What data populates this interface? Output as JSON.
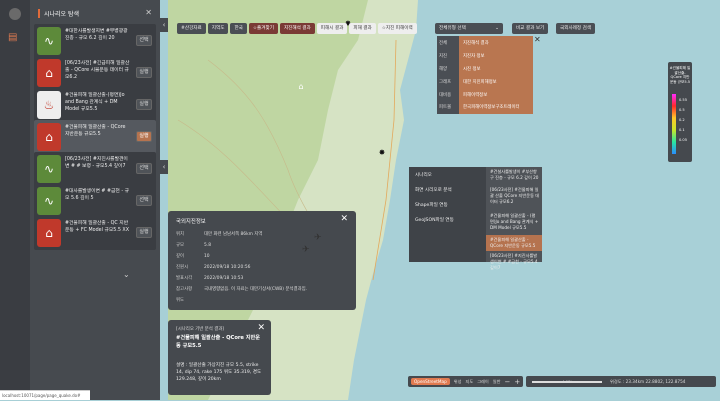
{
  "sidebar": {
    "panel_title": "시나리오 탐색",
    "items": [
      {
        "text": "#대한사를발생지변 #부병광광진층 - 규모 6.2 깊이 20",
        "button": "선택",
        "icon": "seismic",
        "color": "green"
      },
      {
        "text": "[06/23사전] #긴급피해 일괄산출 - QCore 시뮬운동 데이터 규모6.2",
        "button": "실행",
        "icon": "house",
        "color": "red"
      },
      {
        "text": "#건물피해 일괄산출-(평면)Jo and Bang 관계식 + DM Model 규모5.5",
        "button": "실행",
        "icon": "collapse",
        "color": "white"
      },
      {
        "text": "#건물피해 일괄산출 - QCore 지반운동 규모5.5",
        "button": "실행",
        "icon": "house",
        "color": "red",
        "active": true
      },
      {
        "text": "[06/23사전] #지진사를발견이변 # # 보령 - 규모5.4 깊이7",
        "button": "선택",
        "icon": "seismic",
        "color": "green"
      },
      {
        "text": "#대사를발생이변 # #금천 - 규모 5.6 깊이 5",
        "button": "선택",
        "icon": "seismic",
        "color": "green"
      },
      {
        "text": "#건물피해 일괄산출 - QC 지반운동 + FC Model 규모5.5 XX",
        "button": "실행",
        "icon": "house",
        "color": "red"
      }
    ]
  },
  "toolbar": {
    "items": [
      "#산강자료",
      "지역도",
      "한국",
      "☆즐겨찾기",
      "지진해석 결과",
      "피해시 결과",
      "피해 결과",
      "☆지진 피해이력"
    ],
    "select_label": "전체유형 선택",
    "btn_compare": "비교 결과 보기",
    "btn_export": "국외사례정 검색"
  },
  "dropdown": {
    "categories": [
      "전체",
      "지진",
      "해양",
      "그래프",
      "대비용",
      "피트볼"
    ],
    "items": [
      "지진해석 결과",
      "지진자 정보",
      "시진 정보",
      "대한 지진피해정보",
      "피해이력정보",
      "한국피해이력정보구조트레이터"
    ]
  },
  "context_menu": {
    "items": [
      "시나리오",
      "화면 시리오로 분석",
      "Shape파일 연동",
      "GeoJSON파일 연동"
    ],
    "results": [
      "#건설사를발생이 #부산항구 진층 - 규모 6.2 깊이 20",
      "[06/23사전] #건물피해 일괄 산출 QCore 지반운동 데이터 규모6.2",
      "#건물피해 일괄산출 - (평면)Jo and Bang 관계식 + DM Model 규모5.5",
      "#건물피해 일괄산출 - QCore 지반운동 규모5.5",
      "[06/23사전] #지진사를발생이변 # #금천 - 규모5.4 깊이7"
    ]
  },
  "info_panel": {
    "title": "국외지진정보",
    "rows": [
      {
        "k": "위치",
        "v": "대만 화련 남남서쪽 86km 지역"
      },
      {
        "k": "규모",
        "v": "5.8"
      },
      {
        "k": "깊이",
        "v": "10"
      },
      {
        "k": "진원시",
        "v": "2022/09/18 10:20:56"
      },
      {
        "k": "발표시각",
        "v": "2022/09/18 10:53"
      },
      {
        "k": "참고사항",
        "v": "국내영향없음. 이 자료는 대만기상서(CWB) 분석결과임."
      },
      {
        "k": "위도",
        "v": ""
      }
    ]
  },
  "sim_panel": {
    "tag": "[시나리오 기반 분석 결과]",
    "title": "#건물피해 일괄산출 - QCore 지반운동 규모5.5",
    "desc": "설명 : 일괄산출 가상지진 규모 5.5, strike 14, dip 74, rake 175 위도 35.319, 경도 129.248, 깊이 20km"
  },
  "legend": {
    "title": "#건물피해 일괄산출-QCore 지반운동 규모5.5",
    "values": [
      "0.55",
      "0.5",
      "0.2",
      "0.1",
      "0.05"
    ]
  },
  "bottom": {
    "layers": [
      "OpenStreetMap",
      "위성",
      "지도",
      "그레이",
      "일반"
    ],
    "scale_label": "4.03km",
    "coords": "위경도 : 23.34km    22.8802, 122.8754"
  },
  "status_url": "localhost:10071/page/page_quake.do#"
}
